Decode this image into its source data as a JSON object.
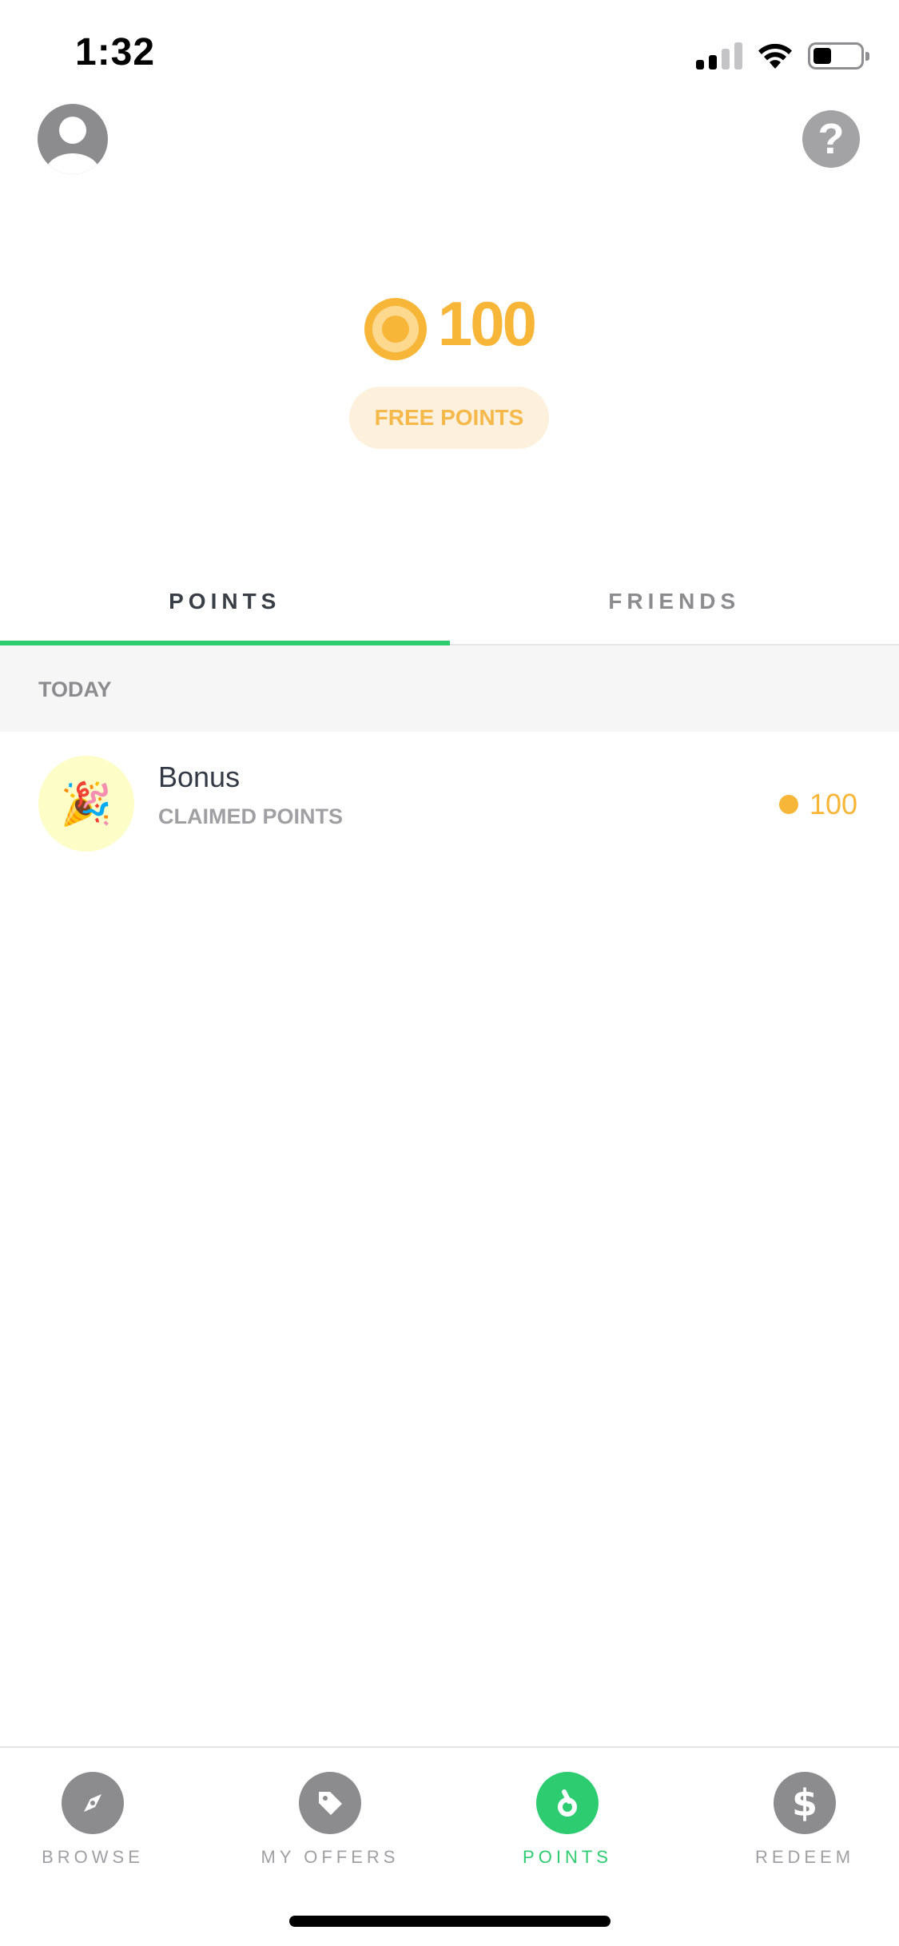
{
  "status_bar": {
    "time": "1:32",
    "signal_icon": "cellular-signal-icon",
    "wifi_icon": "wifi-icon",
    "battery_icon": "battery-icon"
  },
  "header": {
    "profile_icon": "user-avatar-icon",
    "help_label": "?"
  },
  "balance": {
    "value": "100",
    "icon": "coin-icon",
    "free_points_label": "FREE POINTS"
  },
  "colors": {
    "accent_green": "#2ecc71",
    "coin_gold": "#f7b638",
    "muted_gray": "#8c8c8f"
  },
  "tabs": [
    {
      "label": "POINTS",
      "active": true
    },
    {
      "label": "FRIENDS",
      "active": false
    }
  ],
  "section": {
    "title": "TODAY"
  },
  "activity": [
    {
      "icon": "party-popper-icon",
      "emoji": "🎉",
      "title": "Bonus",
      "subtitle": "CLAIMED POINTS",
      "points": "100"
    }
  ],
  "tabbar": [
    {
      "label": "BROWSE",
      "icon": "compass-icon",
      "active": false
    },
    {
      "label": "MY OFFERS",
      "icon": "tag-icon",
      "active": false
    },
    {
      "label": "POINTS",
      "icon": "points-icon",
      "active": true
    },
    {
      "label": "REDEEM",
      "icon": "dollar-icon",
      "active": false
    }
  ]
}
